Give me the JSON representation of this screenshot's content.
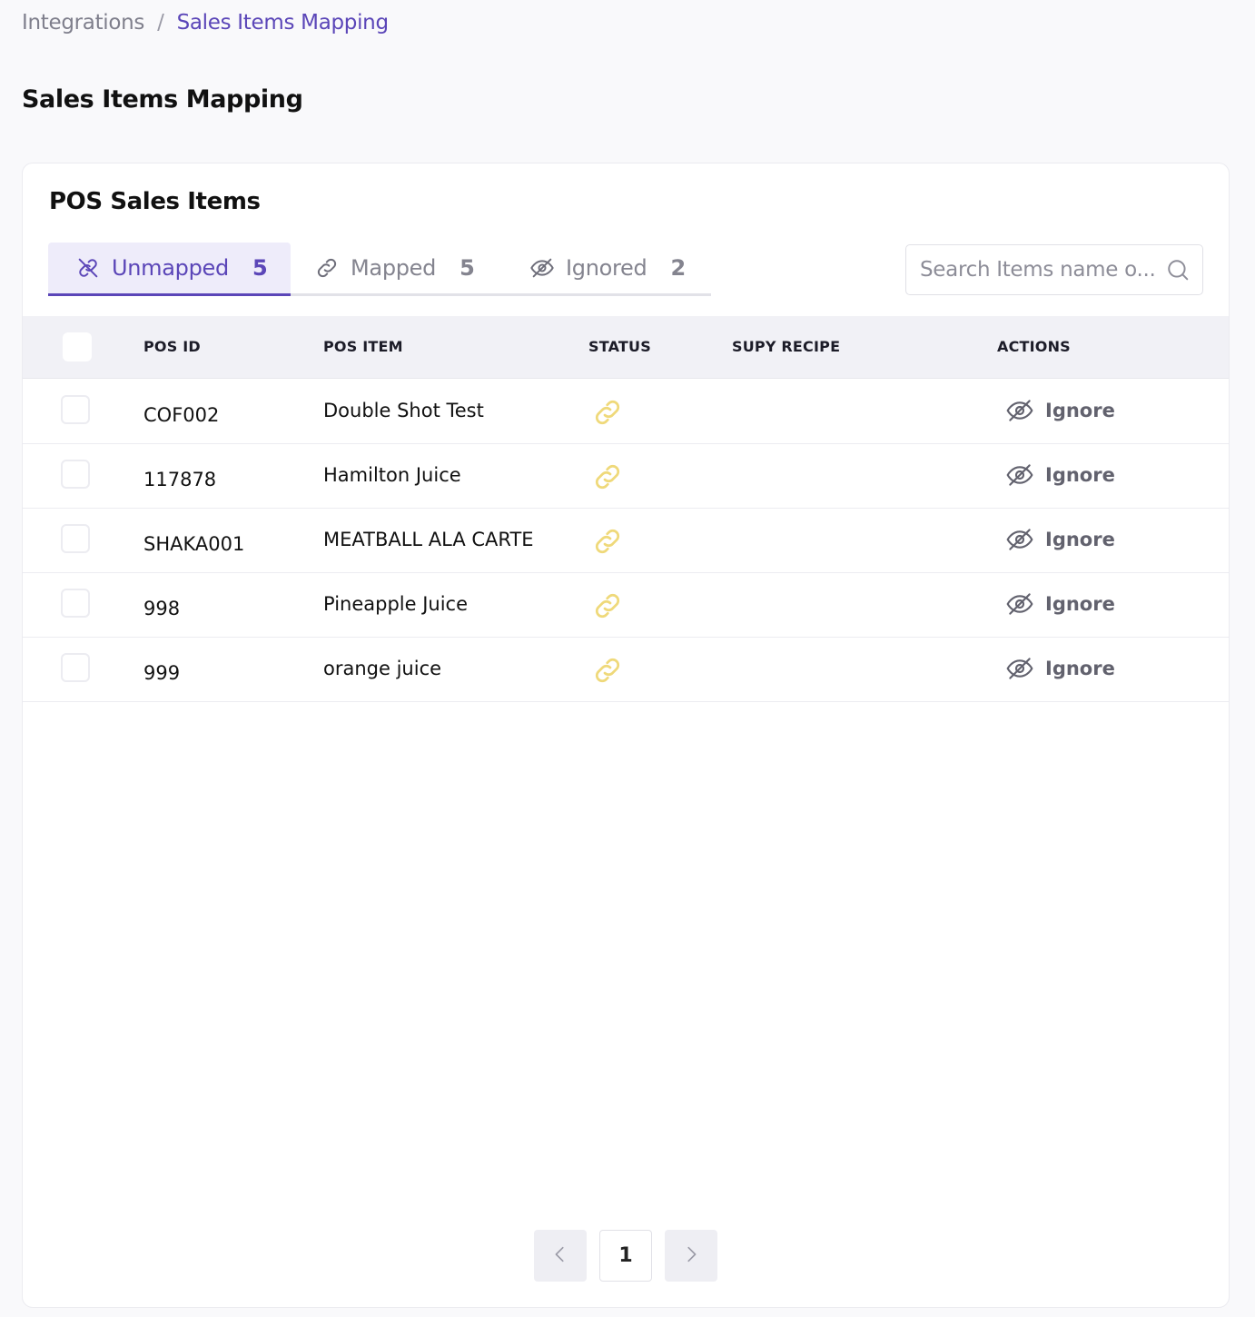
{
  "breadcrumb": {
    "root": "Integrations",
    "separator": "/",
    "current": "Sales Items Mapping"
  },
  "page": {
    "title": "Sales Items Mapping"
  },
  "card": {
    "title": "POS Sales Items"
  },
  "tabs": [
    {
      "label": "Unmapped",
      "count": "5",
      "icon": "unlink-icon",
      "active": true
    },
    {
      "label": "Mapped",
      "count": "5",
      "icon": "link-icon",
      "active": false
    },
    {
      "label": "Ignored",
      "count": "2",
      "icon": "eye-off-icon",
      "active": false
    }
  ],
  "search": {
    "placeholder": "Search Items name o...",
    "value": "",
    "icon": "search-icon"
  },
  "table": {
    "columns": [
      "POS ID",
      "POS ITEM",
      "STATUS",
      "SUPY RECIPE",
      "ACTIONS"
    ],
    "rows": [
      {
        "pos_id": "COF002",
        "pos_item": "Double Shot Test",
        "status_icon": "link-icon",
        "supy_recipe": "",
        "action": "Ignore"
      },
      {
        "pos_id": "117878",
        "pos_item": "Hamilton Juice",
        "status_icon": "link-icon",
        "supy_recipe": "",
        "action": "Ignore"
      },
      {
        "pos_id": "SHAKA001",
        "pos_item": "MEATBALL ALA CARTE",
        "status_icon": "link-icon",
        "supy_recipe": "",
        "action": "Ignore"
      },
      {
        "pos_id": "998",
        "pos_item": "Pineapple Juice",
        "status_icon": "link-icon",
        "supy_recipe": "",
        "action": "Ignore"
      },
      {
        "pos_id": "999",
        "pos_item": "orange juice",
        "status_icon": "link-icon",
        "supy_recipe": "",
        "action": "Ignore"
      }
    ]
  },
  "pagination": {
    "current_page": "1",
    "prev_icon": "chevron-left-icon",
    "next_icon": "chevron-right-icon"
  },
  "colors": {
    "accent": "#5b46b8",
    "status_link": "#efd97a",
    "muted_text": "#84848f",
    "header_bg": "#f1f1f6"
  }
}
